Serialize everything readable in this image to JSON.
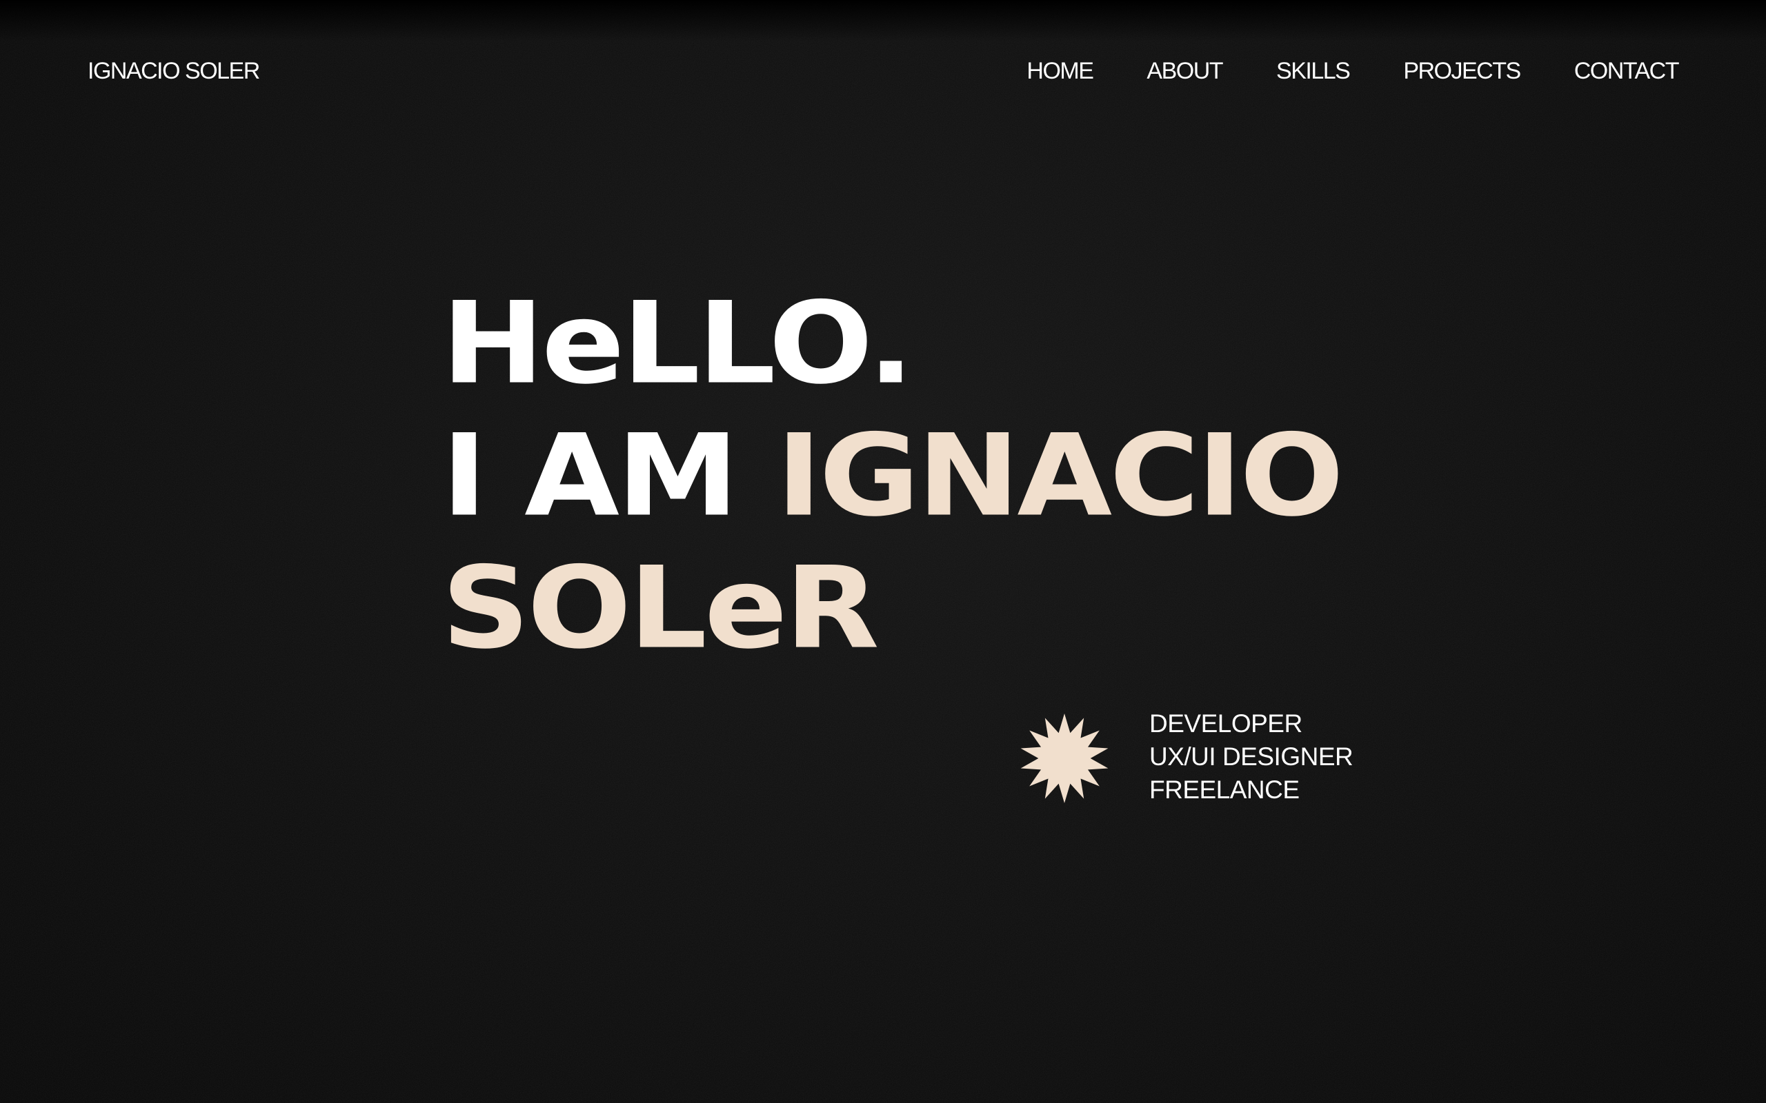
{
  "header": {
    "brand": "IGNACIO SOLER",
    "nav": [
      "HOME",
      "ABOUT",
      "SKILLS",
      "PROJECTS",
      "CONTACT"
    ]
  },
  "hero": {
    "line1": "HeLLO.",
    "line2_white": "I AM",
    "line2_accent": "IGNACIO",
    "line3": "SOLeR"
  },
  "roles": {
    "icon": "starburst-icon",
    "items": [
      "DEVELOPER",
      "UX/UI DESIGNER",
      "FREELANCE"
    ]
  },
  "colors": {
    "background": "#0d0d0d",
    "text": "#ffffff",
    "accent": "#f1dfcd"
  }
}
